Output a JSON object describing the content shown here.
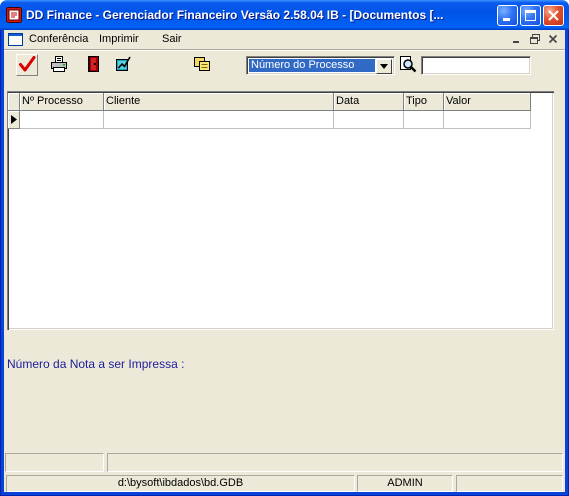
{
  "window": {
    "title": "DD Finance - Gerenciador Financeiro Versão 2.58.04 IB - [Documentos [...",
    "icon": "app-icon",
    "title_buttons": [
      "minimize-icon",
      "maximize-icon",
      "close-icon"
    ]
  },
  "menu": {
    "doc_icon": "mdi-window-icon",
    "items": [
      "Conferência",
      "Imprimir",
      "Sair"
    ],
    "mdi_controls": [
      "minimize-icon",
      "restore-icon",
      "close-icon"
    ]
  },
  "toolbar": {
    "buttons": [
      "checkmark-icon",
      "printer-icon",
      "exit-door-icon",
      "edit-chart-icon",
      "copy-folder-icon"
    ],
    "search_field": {
      "selected": "Número do Processo",
      "dropdown_icon": "chevron-down-icon"
    },
    "search_button_icon": "magnifier-icon",
    "search_input": {
      "value": ""
    }
  },
  "grid": {
    "columns": [
      "Nº Processo",
      "Cliente",
      "Data",
      "Tipo",
      "Valor"
    ],
    "rows": [
      [
        "",
        "",
        "",
        "",
        ""
      ]
    ],
    "current_row": 0
  },
  "nota_label": "Número da Nota a ser Impressa :",
  "status_top": {
    "panels": [
      "",
      ""
    ]
  },
  "status_bottom": {
    "panels": [
      "d:\\bysoft\\ibdados\\bd.GDB",
      "ADMIN",
      ""
    ]
  },
  "colors": {
    "titlebar": "#0054e3",
    "client_background": "#ece9d8",
    "selection": "#316ac5",
    "label_text": "#1c1c9c",
    "close_button": "#e0512e"
  }
}
